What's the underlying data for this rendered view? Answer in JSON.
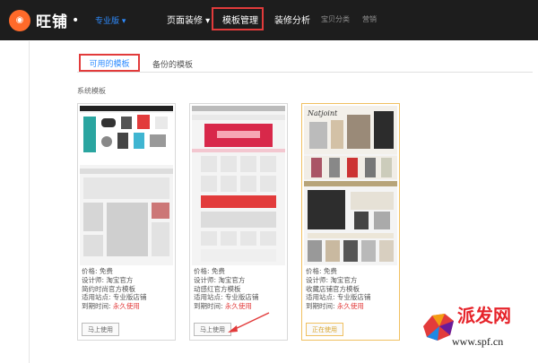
{
  "app": {
    "logo_text": "旺铺",
    "edition": "专业版"
  },
  "nav": {
    "items": [
      {
        "label": "页面装修 ▾"
      },
      {
        "label": "模板管理"
      },
      {
        "label": "装修分析"
      },
      {
        "label": "宝贝分类"
      },
      {
        "label": "营销"
      }
    ]
  },
  "tabs": {
    "active": "可用的模板",
    "other": "备份的模板"
  },
  "section_title": "系统模板",
  "cards": [
    {
      "price_label": "价格: 免费",
      "designer": "设计师: 淘宝官方",
      "name": "简约时尚官方模板",
      "site": "适用站点: 专业版店铺",
      "expire_label": "到期时间: ",
      "expire_value": "永久使用",
      "button": "马上使用"
    },
    {
      "price_label": "价格: 免费",
      "designer": "设计师: 淘宝官方",
      "name": "动感红官方模板",
      "site": "适用站点: 专业版店铺",
      "expire_label": "到期时间: ",
      "expire_value": "永久使用",
      "button": "马上使用"
    },
    {
      "price_label": "价格: 免费",
      "designer": "设计师: 淘宝官方",
      "name": "收藏店铺官方模板",
      "site": "适用站点: 专业版店铺",
      "expire_label": "到期时间: ",
      "expire_value": "永久使用",
      "button": "正在使用"
    }
  ],
  "watermark": {
    "cn": "派发网",
    "url": "www.spf.cn",
    "brand": "Natjoint"
  },
  "colors": {
    "accent": "#2f8cff",
    "highlight": "#e23b3b",
    "topbar": "#1d1d1d",
    "logo": "#ff6a2a",
    "in_use": "#d9a630"
  }
}
